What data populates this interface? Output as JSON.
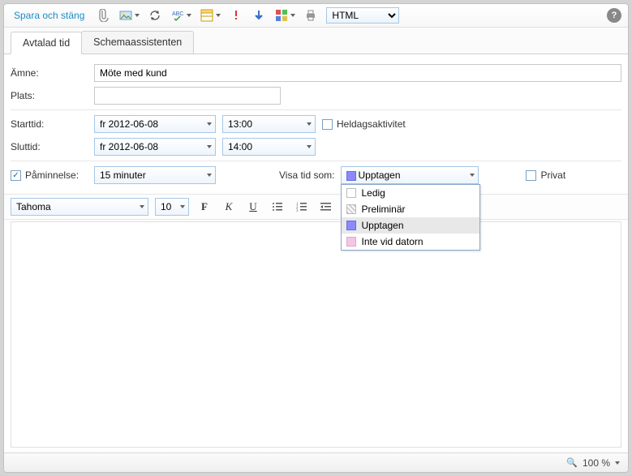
{
  "toolbar": {
    "save_close": "Spara och stäng",
    "format_selected": "HTML",
    "format_options": [
      "HTML"
    ]
  },
  "tabs": {
    "appointment": "Avtalad tid",
    "scheduling": "Schemaassistenten"
  },
  "form": {
    "subject_label": "Ämne:",
    "subject_value": "Möte med kund",
    "location_label": "Plats:",
    "location_value": "",
    "start_label": "Starttid:",
    "start_date": "fr 2012-06-08",
    "start_time": "13:00",
    "end_label": "Sluttid:",
    "end_date": "fr 2012-06-08",
    "end_time": "14:00",
    "allday_label": "Heldagsaktivitet",
    "allday_checked": false,
    "reminder_label": "Påminnelse:",
    "reminder_value": "15 minuter",
    "reminder_checked": true,
    "showas_label": "Visa tid som:",
    "showas_value": "Upptagen",
    "showas_options": {
      "free": "Ledig",
      "tentative": "Preliminär",
      "busy": "Upptagen",
      "oof": "Inte vid datorn"
    },
    "private_label": "Privat",
    "private_checked": false
  },
  "fmt": {
    "font": "Tahoma",
    "size": "10"
  },
  "statusbar": {
    "zoom": "100 %"
  }
}
